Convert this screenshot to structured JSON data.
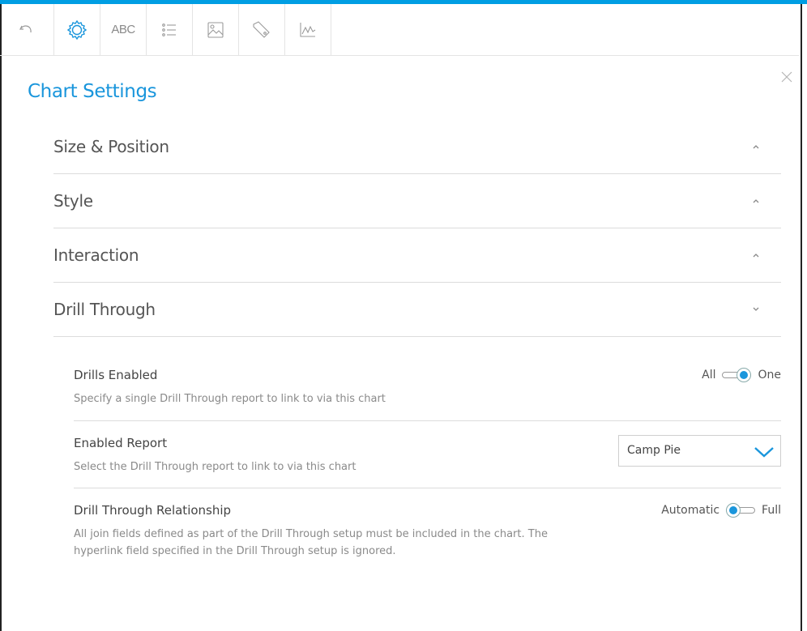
{
  "toolbar": {
    "items": [
      {
        "name": "undo-icon"
      },
      {
        "name": "gear-icon",
        "active": true
      },
      {
        "name": "text-icon",
        "label": "ABC"
      },
      {
        "name": "list-icon"
      },
      {
        "name": "image-icon"
      },
      {
        "name": "tag-icon"
      },
      {
        "name": "line-chart-icon"
      }
    ]
  },
  "colors": {
    "accent": "#1a96dc",
    "topbar": "#009ee3"
  },
  "panel": {
    "title": "Chart Settings",
    "sections": [
      {
        "label": "Size & Position",
        "state": "collapsed"
      },
      {
        "label": "Style",
        "state": "collapsed"
      },
      {
        "label": "Interaction",
        "state": "collapsed"
      },
      {
        "label": "Drill Through",
        "state": "expanded"
      }
    ]
  },
  "drill": {
    "drills_enabled": {
      "label": "Drills Enabled",
      "description": "Specify a single Drill Through report to link to via this chart",
      "left_option": "All",
      "right_option": "One",
      "selected": "One"
    },
    "enabled_report": {
      "label": "Enabled Report",
      "description": "Select the Drill Through report to link to via this chart",
      "value": "Camp Pie"
    },
    "relationship": {
      "label": "Drill Through Relationship",
      "description_line1": "All join fields defined as part of the Drill Through setup must be included in the chart. The",
      "description_line2": "hyperlink field specified in the Drill Through setup is ignored.",
      "left_option": "Automatic",
      "right_option": "Full",
      "selected": "Automatic"
    }
  }
}
